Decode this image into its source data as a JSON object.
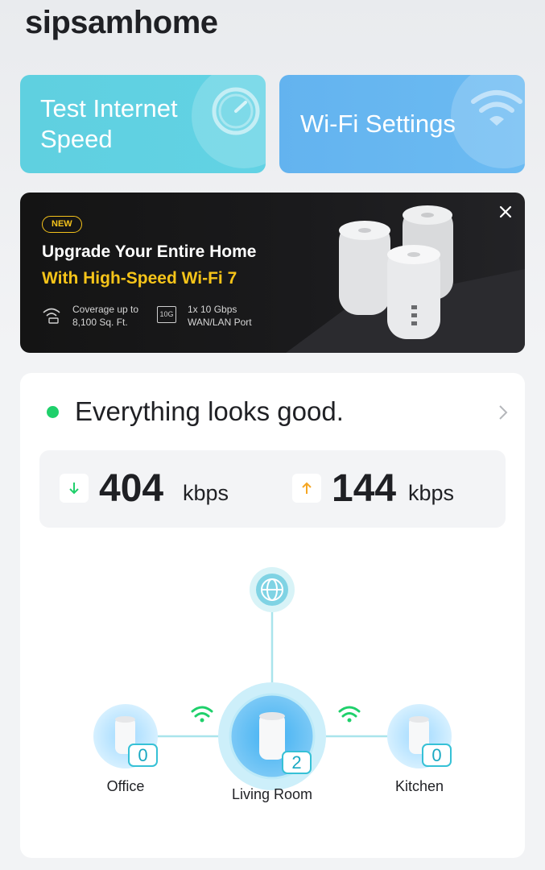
{
  "header": {
    "title": "sipsamhome"
  },
  "actions": {
    "speed_test_label": "Test Internet Speed",
    "wifi_settings_label": "Wi-Fi Settings"
  },
  "promo": {
    "badge": "NEW",
    "headline": "Upgrade Your Entire Home",
    "subheadline": "With High-Speed Wi-Fi 7",
    "feature1_line1": "Coverage up to",
    "feature1_line2": "8,100 Sq. Ft.",
    "feature2_line1": "1x 10 Gbps",
    "feature2_line2": "WAN/LAN Port",
    "port_icon_text": "10G"
  },
  "status": {
    "message": "Everything looks good.",
    "download_value": "404",
    "download_unit": "kbps",
    "upload_value": "144",
    "upload_unit": "kbps"
  },
  "network": {
    "nodes": [
      {
        "name": "Office",
        "clients": "0"
      },
      {
        "name": "Living Room",
        "clients": "2"
      },
      {
        "name": "Kitchen",
        "clients": "0"
      }
    ]
  },
  "colors": {
    "speed_card": "#5fd0e0",
    "wifi_card": "#63b3ef",
    "accent_yellow": "#f6c419",
    "status_green": "#1fd06b",
    "topology_cyan": "#36c1d6",
    "wifi_signal_green": "#1fd06b",
    "download_arrow": "#1fd06b",
    "upload_arrow": "#f5a623"
  },
  "icons": {
    "speed": "speedometer-icon",
    "wifi": "wifi-icon",
    "close": "close-icon",
    "chevron": "chevron-right-icon",
    "internet": "globe-icon"
  }
}
